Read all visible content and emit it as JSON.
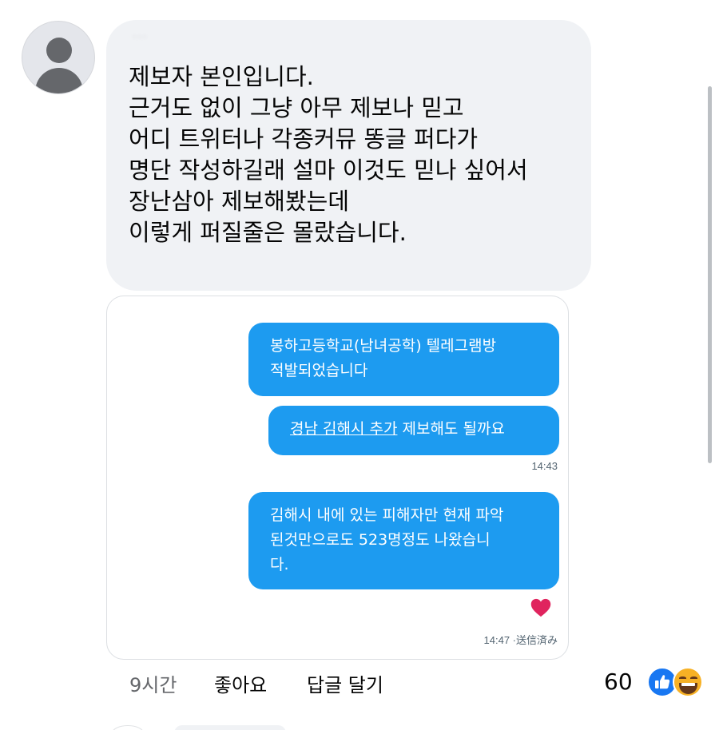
{
  "comment": {
    "author_name": "···",
    "lines": [
      "제보자 본인입니다.",
      "근거도 없이 그냥 아무 제보나 믿고",
      "어디 트위터나 각종커뮤 똥글 퍼다가",
      "명단 작성하길래 설마 이것도 믿나 싶어서",
      "장난삼아 제보해봤는데",
      "이렇게 퍼질줄은 몰랐습니다."
    ]
  },
  "attachment": {
    "message_1": [
      "봉하고등학교(남녀공학) 텔레그램방",
      "적발되었습니다"
    ],
    "message_2": {
      "underlined": "경남 김해시 추가",
      "rest": " 제보해도 될까요"
    },
    "timestamp_1": "14:43",
    "message_3": [
      "김해시 내에 있는 피해자만 현재 파악",
      "된것만으로도 523명정도 나왔습니",
      "다."
    ],
    "timestamp_2": "14:47 ·送信済み"
  },
  "actions": {
    "time": "9시간",
    "like": "좋아요",
    "reply": "답글 달기"
  },
  "reactions": {
    "count": "60",
    "icons": [
      "like-icon",
      "haha-icon"
    ],
    "like_color": "#1877f2",
    "haha_color": "#f7b125"
  },
  "colors": {
    "bubble": "#f0f2f5",
    "message_blue": "#1d9bf0"
  }
}
